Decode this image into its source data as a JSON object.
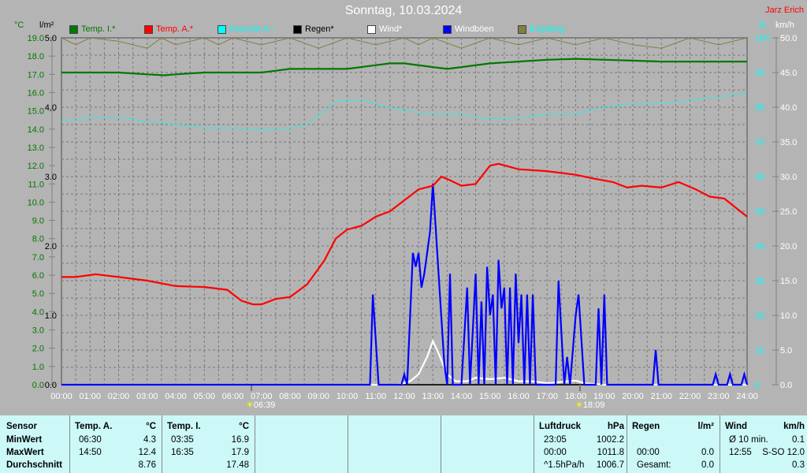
{
  "title": "Sonntag, 10.03.2024",
  "author": "Jarz Erich",
  "units": {
    "left1": "°C",
    "left2": "l/m²",
    "right1": "%",
    "right2": "km/h"
  },
  "legend": [
    {
      "label": "Temp. I.*",
      "color": "#007800",
      "text": "#007800"
    },
    {
      "label": "Temp. A.*",
      "color": "#ff0000",
      "text": "#ff0000"
    },
    {
      "label": "Feuchte A.*",
      "color": "#00ffff",
      "text": "#00ffff"
    },
    {
      "label": "Regen*",
      "color": "#000000",
      "text": "#000000"
    },
    {
      "label": "Wind*",
      "color": "#ffffff",
      "text": "#ffffff"
    },
    {
      "label": "Windböen",
      "color": "#0000ff",
      "text": "#ffffff"
    },
    {
      "label": "Empfang",
      "color": "#808040",
      "text": "#00ffff"
    }
  ],
  "sun": {
    "sunrise": "06:39",
    "sunset": "18:09"
  },
  "chart_data": {
    "type": "line",
    "x_ticks": [
      "00:00",
      "01:00",
      "02:00",
      "03:00",
      "04:00",
      "05:00",
      "06:00",
      "07:00",
      "08:00",
      "09:00",
      "10:00",
      "11:00",
      "12:00",
      "13:00",
      "14:00",
      "15:00",
      "16:00",
      "17:00",
      "18:00",
      "19:00",
      "20:00",
      "21:00",
      "22:00",
      "23:00",
      "24:00"
    ],
    "xlim": [
      0,
      24
    ],
    "axes": {
      "temp": {
        "range": [
          0,
          19
        ],
        "ticks": [
          "0.0",
          "1.0",
          "2.0",
          "3.0",
          "4.0",
          "5.0",
          "6.0",
          "7.0",
          "8.0",
          "9.0",
          "10.0",
          "11.0",
          "12.0",
          "13.0",
          "14.0",
          "15.0",
          "16.0",
          "17.0",
          "18.0",
          "19.0"
        ]
      },
      "rain": {
        "range": [
          0,
          5
        ],
        "ticks": [
          "0.0",
          "1.0",
          "2.0",
          "3.0",
          "4.0",
          "5.0"
        ]
      },
      "hum": {
        "range": [
          0,
          100
        ],
        "ticks": [
          "0",
          "10",
          "20",
          "30",
          "40",
          "50",
          "60",
          "70",
          "80",
          "90",
          "100"
        ]
      },
      "wind": {
        "range": [
          0,
          50
        ],
        "ticks": [
          "0.0",
          "5.0",
          "10.0",
          "15.0",
          "20.0",
          "25.0",
          "30.0",
          "35.0",
          "40.0",
          "45.0",
          "50.0"
        ]
      }
    },
    "series": [
      {
        "name": "Temp. I.",
        "axis": "temp",
        "color": "#007800",
        "points": [
          [
            0,
            17.1
          ],
          [
            2,
            17.1
          ],
          [
            3,
            17.0
          ],
          [
            3.6,
            16.95
          ],
          [
            4,
            17.0
          ],
          [
            5,
            17.1
          ],
          [
            7,
            17.1
          ],
          [
            7.5,
            17.2
          ],
          [
            8,
            17.3
          ],
          [
            10,
            17.3
          ],
          [
            11,
            17.5
          ],
          [
            11.5,
            17.6
          ],
          [
            12,
            17.6
          ],
          [
            13,
            17.4
          ],
          [
            13.5,
            17.3
          ],
          [
            14,
            17.4
          ],
          [
            15,
            17.6
          ],
          [
            16,
            17.7
          ],
          [
            17,
            17.8
          ],
          [
            18,
            17.85
          ],
          [
            19,
            17.8
          ],
          [
            20,
            17.75
          ],
          [
            21,
            17.7
          ],
          [
            24,
            17.7
          ]
        ]
      },
      {
        "name": "Temp. A.",
        "axis": "temp",
        "color": "#ff0000",
        "points": [
          [
            0,
            5.9
          ],
          [
            0.5,
            5.9
          ],
          [
            1.2,
            6.05
          ],
          [
            2,
            5.9
          ],
          [
            3,
            5.7
          ],
          [
            4,
            5.4
          ],
          [
            5,
            5.35
          ],
          [
            5.8,
            5.2
          ],
          [
            6.3,
            4.6
          ],
          [
            6.7,
            4.4
          ],
          [
            7,
            4.4
          ],
          [
            7.5,
            4.7
          ],
          [
            8,
            4.8
          ],
          [
            8.6,
            5.5
          ],
          [
            9.2,
            6.8
          ],
          [
            9.6,
            8.0
          ],
          [
            10,
            8.5
          ],
          [
            10.5,
            8.7
          ],
          [
            11,
            9.2
          ],
          [
            11.5,
            9.5
          ],
          [
            12,
            10.1
          ],
          [
            12.5,
            10.7
          ],
          [
            13,
            10.9
          ],
          [
            13.3,
            11.4
          ],
          [
            13.6,
            11.2
          ],
          [
            14,
            10.9
          ],
          [
            14.5,
            11.0
          ],
          [
            15,
            12.0
          ],
          [
            15.3,
            12.1
          ],
          [
            16,
            11.8
          ],
          [
            17,
            11.7
          ],
          [
            18,
            11.5
          ],
          [
            18.6,
            11.3
          ],
          [
            19.3,
            11.1
          ],
          [
            19.8,
            10.8
          ],
          [
            20.3,
            10.9
          ],
          [
            21,
            10.8
          ],
          [
            21.6,
            11.1
          ],
          [
            22.2,
            10.7
          ],
          [
            22.7,
            10.3
          ],
          [
            23.2,
            10.2
          ],
          [
            23.6,
            9.7
          ],
          [
            24,
            9.2
          ]
        ]
      },
      {
        "name": "Feuchte A.",
        "axis": "hum",
        "color": "#00ffff",
        "dashed": true,
        "points": [
          [
            0,
            76
          ],
          [
            1,
            77
          ],
          [
            2,
            77
          ],
          [
            3,
            76
          ],
          [
            4,
            75
          ],
          [
            5,
            74
          ],
          [
            6,
            74
          ],
          [
            7,
            73.5
          ],
          [
            8,
            74
          ],
          [
            8.6,
            75
          ],
          [
            9.2,
            79
          ],
          [
            9.7,
            82
          ],
          [
            10.5,
            82
          ],
          [
            11,
            81
          ],
          [
            12,
            79
          ],
          [
            13,
            78
          ],
          [
            14,
            78
          ],
          [
            15,
            76.5
          ],
          [
            16,
            77
          ],
          [
            17,
            78
          ],
          [
            18,
            78
          ],
          [
            19,
            80
          ],
          [
            20,
            81
          ],
          [
            21,
            81
          ],
          [
            22,
            82
          ],
          [
            23,
            83
          ],
          [
            24,
            84
          ]
        ]
      },
      {
        "name": "Windböen",
        "axis": "wind",
        "color": "#0000ff",
        "points": [
          [
            0,
            0
          ],
          [
            10.8,
            0
          ],
          [
            10.9,
            13
          ],
          [
            11.1,
            0
          ],
          [
            11.9,
            0
          ],
          [
            12.0,
            1.5
          ],
          [
            12.1,
            0
          ],
          [
            12.3,
            19
          ],
          [
            12.4,
            17
          ],
          [
            12.5,
            19
          ],
          [
            12.6,
            14
          ],
          [
            12.7,
            16
          ],
          [
            12.9,
            22
          ],
          [
            13.0,
            29
          ],
          [
            13.2,
            16
          ],
          [
            13.4,
            3
          ],
          [
            13.5,
            0
          ],
          [
            13.6,
            16
          ],
          [
            13.7,
            0
          ],
          [
            14.0,
            0
          ],
          [
            14.2,
            14
          ],
          [
            14.3,
            0
          ],
          [
            14.5,
            16
          ],
          [
            14.6,
            0
          ],
          [
            14.7,
            12
          ],
          [
            14.8,
            0
          ],
          [
            14.9,
            17
          ],
          [
            15.0,
            10
          ],
          [
            15.1,
            13
          ],
          [
            15.2,
            0
          ],
          [
            15.3,
            18
          ],
          [
            15.4,
            11
          ],
          [
            15.5,
            14
          ],
          [
            15.6,
            0
          ],
          [
            15.7,
            14
          ],
          [
            15.8,
            0
          ],
          [
            15.9,
            16
          ],
          [
            16.0,
            6
          ],
          [
            16.1,
            13
          ],
          [
            16.2,
            0
          ],
          [
            16.3,
            13
          ],
          [
            16.4,
            0
          ],
          [
            16.5,
            13
          ],
          [
            16.6,
            0
          ],
          [
            17.3,
            0
          ],
          [
            17.4,
            15
          ],
          [
            17.6,
            0
          ],
          [
            17.7,
            4
          ],
          [
            17.8,
            0
          ],
          [
            17.9,
            5
          ],
          [
            18.0,
            10
          ],
          [
            18.1,
            13
          ],
          [
            18.3,
            0
          ],
          [
            18.7,
            0
          ],
          [
            18.8,
            11
          ],
          [
            18.9,
            0
          ],
          [
            19.0,
            13
          ],
          [
            19.1,
            0
          ],
          [
            20.7,
            0
          ],
          [
            20.8,
            5
          ],
          [
            20.9,
            0
          ],
          [
            22.8,
            0
          ],
          [
            22.9,
            1.5
          ],
          [
            23.0,
            0
          ],
          [
            23.3,
            0
          ],
          [
            23.4,
            1.5
          ],
          [
            23.5,
            0
          ],
          [
            23.8,
            0
          ],
          [
            23.9,
            1.5
          ],
          [
            24,
            0
          ]
        ]
      },
      {
        "name": "Wind",
        "axis": "wind",
        "color": "#ffffff",
        "points": [
          [
            0,
            0
          ],
          [
            11.8,
            0
          ],
          [
            12.2,
            0.5
          ],
          [
            12.5,
            1.5
          ],
          [
            12.8,
            4
          ],
          [
            13.0,
            6.3
          ],
          [
            13.2,
            4.5
          ],
          [
            13.5,
            1.5
          ],
          [
            13.8,
            0.5
          ],
          [
            14.2,
            0.5
          ],
          [
            14.5,
            1
          ],
          [
            15,
            0.8
          ],
          [
            15.5,
            1
          ],
          [
            16,
            0.5
          ],
          [
            16.5,
            0.5
          ],
          [
            17,
            0.2
          ],
          [
            18,
            0.6
          ],
          [
            18.3,
            0.2
          ],
          [
            19,
            0
          ],
          [
            24,
            0
          ]
        ]
      },
      {
        "name": "Empfang",
        "axis": "hum",
        "color": "#808040",
        "points": [
          [
            0,
            100
          ],
          [
            0.5,
            98
          ],
          [
            1,
            100
          ],
          [
            2,
            99
          ],
          [
            3,
            97
          ],
          [
            3.5,
            100
          ],
          [
            4,
            98
          ],
          [
            5,
            100
          ],
          [
            5.5,
            98
          ],
          [
            6,
            100
          ],
          [
            7,
            98
          ],
          [
            8,
            100
          ],
          [
            9,
            97
          ],
          [
            10,
            100
          ],
          [
            11,
            98
          ],
          [
            12,
            100
          ],
          [
            12.5,
            98
          ],
          [
            13,
            100
          ],
          [
            14,
            97
          ],
          [
            15,
            100
          ],
          [
            16,
            98
          ],
          [
            17,
            100
          ],
          [
            18,
            98
          ],
          [
            19,
            100
          ],
          [
            20,
            98
          ],
          [
            21,
            97
          ],
          [
            22,
            100
          ],
          [
            23,
            98
          ],
          [
            24,
            100
          ]
        ]
      }
    ]
  },
  "table": {
    "sensor": {
      "head": "Sensor",
      "rows": [
        "MinWert",
        "MaxWert",
        "Durchschnitt"
      ]
    },
    "tempA": {
      "head": "Temp. A.",
      "unit": "°C",
      "times": [
        "06:30",
        "14:50",
        ""
      ],
      "values": [
        "4.3",
        "12.4",
        "8.76"
      ]
    },
    "tempI": {
      "head": "Temp. I.",
      "unit": "°C",
      "times": [
        "03:35",
        "16:35",
        ""
      ],
      "values": [
        "16.9",
        "17.9",
        "17.48"
      ]
    },
    "pressure": {
      "head": "Luftdruck",
      "unit": "hPa",
      "times": [
        "23:05",
        "00:00",
        "^1.5hPa/h"
      ],
      "values": [
        "1002.2",
        "1011.8",
        "1006.7"
      ]
    },
    "rain": {
      "head": "Regen",
      "unit": "l/m²",
      "times": [
        "",
        "00:00",
        "Gesamt:"
      ],
      "values": [
        "",
        "0.0",
        "0.0"
      ]
    },
    "wind": {
      "head": "Wind",
      "unit": "km/h",
      "times": [
        "Ø 10 min.",
        "12:55",
        ""
      ],
      "values": [
        "0.1",
        "S-SO 12.0",
        "0.3"
      ]
    }
  }
}
